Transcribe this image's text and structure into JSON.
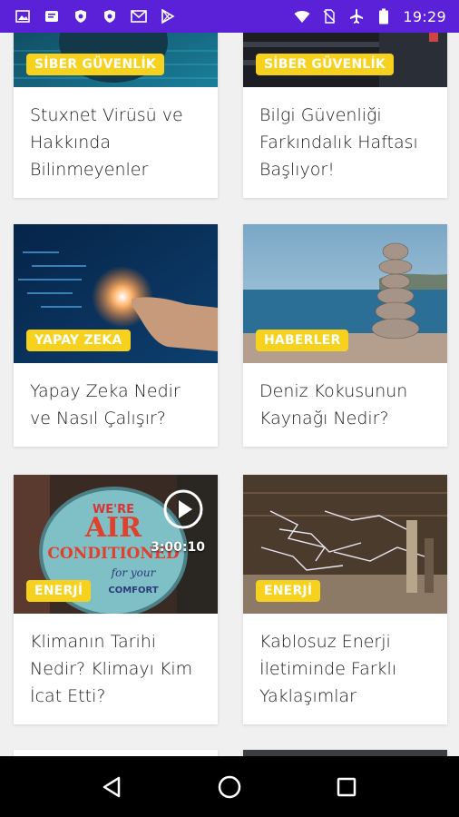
{
  "status_bar": {
    "time": "19:29",
    "left_icons": [
      "gallery-icon",
      "message-icon",
      "shield-icon",
      "shield-icon",
      "mail-icon",
      "play-store-icon"
    ],
    "right_icons": [
      "wifi-icon",
      "no-sim-icon",
      "airplane-icon",
      "battery-icon"
    ],
    "color": "#5b21d8"
  },
  "articles": [
    {
      "category": "SİBER GÜVENLİK",
      "title": "Stuxnet Virüsü ve Hakkında Bilinmeyenler"
    },
    {
      "category": "SİBER GÜVENLİK",
      "title": "Bilgi Güvenliği Farkındalık Haftası Başlıyor!"
    },
    {
      "category": "YAPAY ZEKA",
      "title": "Yapay Zeka Nedir ve Nasıl Çalışır?"
    },
    {
      "category": "HABERLER",
      "title": "Deniz Kokusunun Kaynağı Nedir?"
    },
    {
      "category": "ENERJİ",
      "title": "Klimanın Tarihi Nedir? Klimayı Kim İcat Etti?",
      "video_duration": "3:00:10",
      "image_text": [
        "WE'RE",
        "AIR",
        "CONDITIONED",
        "for your",
        "COMFORT"
      ]
    },
    {
      "category": "ENERJİ",
      "title": "Kablosuz Enerji İletiminde Farklı Yaklaşımlar"
    }
  ],
  "badge_color": "#f6d21e",
  "nav": {
    "back": "back-icon",
    "home": "home-icon",
    "recents": "recents-icon"
  }
}
